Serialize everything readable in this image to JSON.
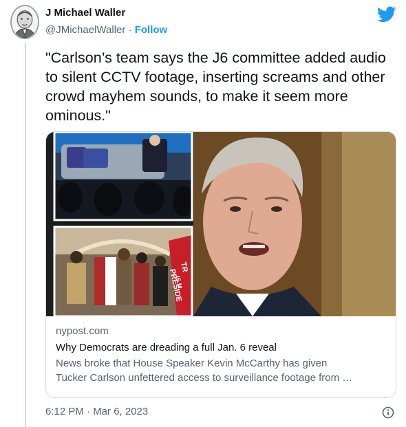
{
  "author": {
    "name": "J Michael Waller",
    "handle": "@JMichaelWaller",
    "separator": " · ",
    "follow_label": "Follow"
  },
  "tweet": {
    "text": "\"Carlson’s team says the J6 committee added audio to silent CCTV footage, inserting screams and other crowd mayhem sounds, to make it seem more ominous.\"",
    "timestamp": "6:12 PM · Mar 6, 2023"
  },
  "card": {
    "domain": "nypost.com",
    "title": "Why Democrats are dreading a full Jan. 6 reveal",
    "description_line1": "News broke that House Speaker Kevin McCarthy has given",
    "description_line2": "Tucker Carlson unfettered access to surveillance footage from …",
    "flag_text_1": "TR",
    "flag_text_2": "IS M",
    "flag_text_3": "PRESIDE"
  },
  "icons": {
    "brand": "twitter-bird-icon",
    "info": "info-icon"
  },
  "colors": {
    "brand_blue": "#1d9bf0",
    "text_primary": "#0f1419",
    "text_secondary": "#536471",
    "border": "#cfd9de"
  }
}
